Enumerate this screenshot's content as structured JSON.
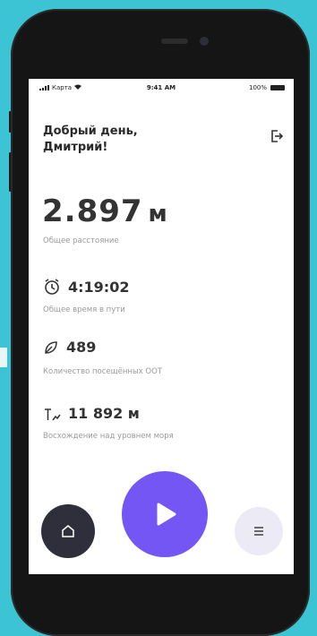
{
  "status_bar": {
    "carrier": "Карта",
    "time": "9:41 AM",
    "battery": "100%"
  },
  "header": {
    "greeting_line1": "Добрый день,",
    "greeting_line2": "Дмитрий!"
  },
  "stats": {
    "distance_value": "2.897",
    "distance_unit": "м",
    "distance_caption": "Общее расстояние",
    "time_value": "4:19:02",
    "time_caption": "Общее время в пути",
    "count_value": "489",
    "count_caption": "Количество посещённых ООТ",
    "elevation_value": "11 892 м",
    "elevation_caption": "Восхождение над уровнем моря"
  },
  "icons": {
    "logout": "logout-icon",
    "timer": "timer-icon",
    "leaf": "leaf-icon",
    "elevation": "elevation-icon",
    "home": "home-icon",
    "play": "play-icon",
    "menu": "menu-icon"
  },
  "colors": {
    "background": "#3cc3d4",
    "accent": "#7456f5",
    "dark_button": "#2f2f3c",
    "light_button": "#eceaf5"
  }
}
